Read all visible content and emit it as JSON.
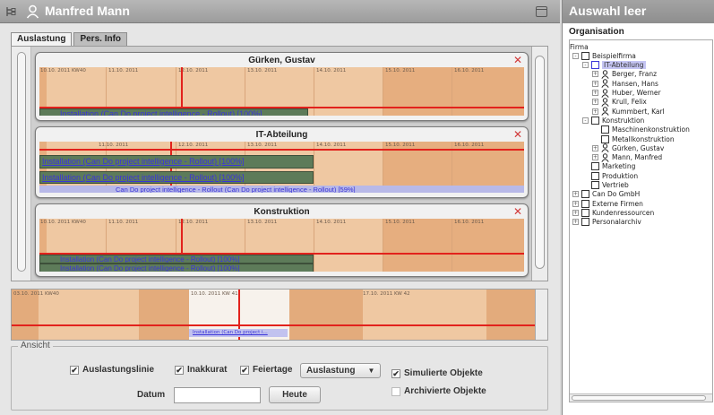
{
  "header": {
    "title": "Manfred Mann"
  },
  "tabs": [
    {
      "label": "Auslastung",
      "active": true
    },
    {
      "label": "Pers. Info",
      "active": false
    }
  ],
  "panels": [
    {
      "title": "Gürken, Gustav",
      "dates": [
        "10.10. 2011 KW40",
        "11.10. 2011",
        "12.10. 2011",
        "13.10. 2011",
        "14.10. 2011",
        "15.10. 2011",
        "16.10. 2011"
      ],
      "bars": [
        "Installation (Can Do project intelligence - Rollout) [100%]"
      ]
    },
    {
      "title": "IT-Abteilung",
      "dates": [
        "10.10. 2011",
        "11.10. 2011",
        "12.10. 2011",
        "13.10. 2011",
        "14.10. 2011",
        "15.10. 2011",
        "16.10. 2011"
      ],
      "bars": [
        "Installation (Can Do project intelligence - Rollout) [100%]",
        "Installation (Can Do project intelligence - Rollout) [100%]",
        "Can Do project intelligence - Rollout (Can Do project intelligence - Rollout) [59%]"
      ]
    },
    {
      "title": "Konstruktion",
      "dates": [
        "10.10. 2011 KW40",
        "11.10. 2011",
        "12.10. 2011",
        "13.10. 2011",
        "14.10. 2011",
        "15.10. 2011",
        "16.10. 2011"
      ],
      "bars": [
        "Installation (Can Do project intelligence - Rollout) [100%]",
        "Installation (Can Do project intelligence - Rollout) [100%]"
      ]
    }
  ],
  "overview": {
    "dates": [
      "03.10. 2011 KW40",
      "10.10. 2011 KW 41",
      "17.10. 2011 KW 42"
    ],
    "bar": "Installation (Can Do project i..."
  },
  "ansicht": {
    "legend": "Ansicht",
    "auslastungslinie": {
      "label": "Auslastungslinie",
      "checked": true
    },
    "inakkurat": {
      "label": "Inakkurat",
      "checked": true
    },
    "feiertage": {
      "label": "Feiertage",
      "checked": true
    },
    "select_value": "Auslastung",
    "simulierte": {
      "label": "Simulierte Objekte",
      "checked": true
    },
    "archivierte": {
      "label": "Archivierte Objekte",
      "checked": false
    },
    "datum_label": "Datum",
    "datum_value": "",
    "heute_label": "Heute"
  },
  "right": {
    "title": "Auswahl leer",
    "org_label": "Organisation",
    "tree": [
      {
        "label": "Firma",
        "indent": 0,
        "type": "root"
      },
      {
        "label": "Beispielfirma",
        "indent": 1,
        "type": "folder",
        "exp": "-"
      },
      {
        "label": "IT-Abteilung",
        "indent": 2,
        "type": "folder",
        "exp": "-",
        "selected": true
      },
      {
        "label": "Berger, Franz",
        "indent": 3,
        "type": "person",
        "exp": "+"
      },
      {
        "label": "Hansen, Hans",
        "indent": 3,
        "type": "person",
        "exp": "+"
      },
      {
        "label": "Huber, Werner",
        "indent": 3,
        "type": "person",
        "exp": "+"
      },
      {
        "label": "Krull, Felix",
        "indent": 3,
        "type": "person",
        "exp": "+"
      },
      {
        "label": "Kummbert, Karl",
        "indent": 3,
        "type": "person",
        "exp": "+"
      },
      {
        "label": "Konstruktion",
        "indent": 2,
        "type": "folder",
        "exp": "-"
      },
      {
        "label": "Maschinenkonstruktion",
        "indent": 3,
        "type": "folder",
        "exp": ""
      },
      {
        "label": "Metallkonstruktion",
        "indent": 3,
        "type": "folder",
        "exp": ""
      },
      {
        "label": "Gürken, Gustav",
        "indent": 3,
        "type": "person",
        "exp": "+"
      },
      {
        "label": "Mann, Manfred",
        "indent": 3,
        "type": "person",
        "exp": "+"
      },
      {
        "label": "Marketing",
        "indent": 2,
        "type": "folder",
        "exp": ""
      },
      {
        "label": "Produktion",
        "indent": 2,
        "type": "folder",
        "exp": ""
      },
      {
        "label": "Vertrieb",
        "indent": 2,
        "type": "folder",
        "exp": ""
      },
      {
        "label": "Can Do GmbH",
        "indent": 1,
        "type": "folder",
        "exp": "+"
      },
      {
        "label": "Externe Firmen",
        "indent": 1,
        "type": "folder",
        "exp": "+"
      },
      {
        "label": "Kundenressourcen",
        "indent": 1,
        "type": "folder",
        "exp": "+"
      },
      {
        "label": "Personalarchiv",
        "indent": 1,
        "type": "folder",
        "exp": "+"
      }
    ]
  },
  "colors": {
    "chart_bg": "#efc8a2",
    "chart_shade": "#e6ae7f",
    "load_line": "#e2221c",
    "bar_green": "#5d7b59",
    "bar_lavender": "#b8b9e8",
    "link_text": "#3b35d8"
  }
}
